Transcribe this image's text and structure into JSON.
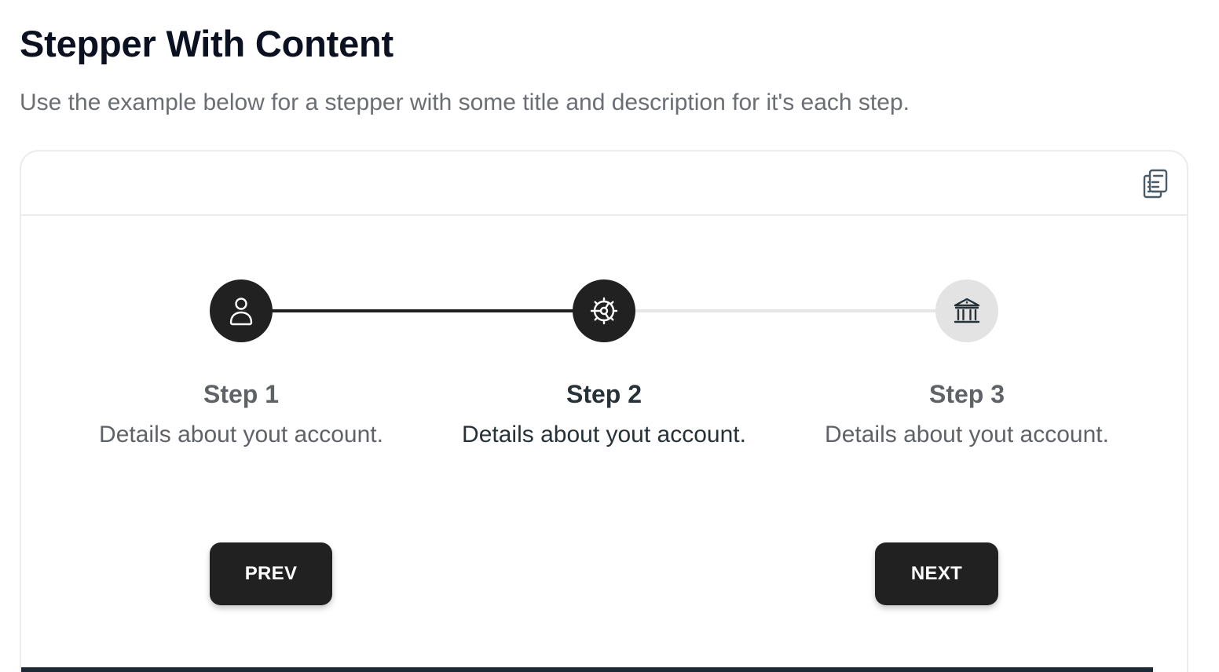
{
  "page": {
    "title": "Stepper With Content",
    "subtitle": "Use the example below for a stepper with some title and description for it's each step."
  },
  "toolbar": {
    "copy_icon": "clipboard-list-icon"
  },
  "stepper": {
    "active_step": 2,
    "steps": [
      {
        "title": "Step 1",
        "description": "Details about yout account.",
        "icon": "user-icon",
        "state": "completed"
      },
      {
        "title": "Step 2",
        "description": "Details about yout account.",
        "icon": "cog-icon",
        "state": "active"
      },
      {
        "title": "Step 3",
        "description": "Details about yout account.",
        "icon": "building-library-icon",
        "state": "upcoming"
      }
    ]
  },
  "buttons": {
    "prev_label": "PREV",
    "next_label": "NEXT"
  },
  "colors": {
    "active": "#212121",
    "inactive": "#e3e3e3",
    "border": "#eaecef"
  }
}
